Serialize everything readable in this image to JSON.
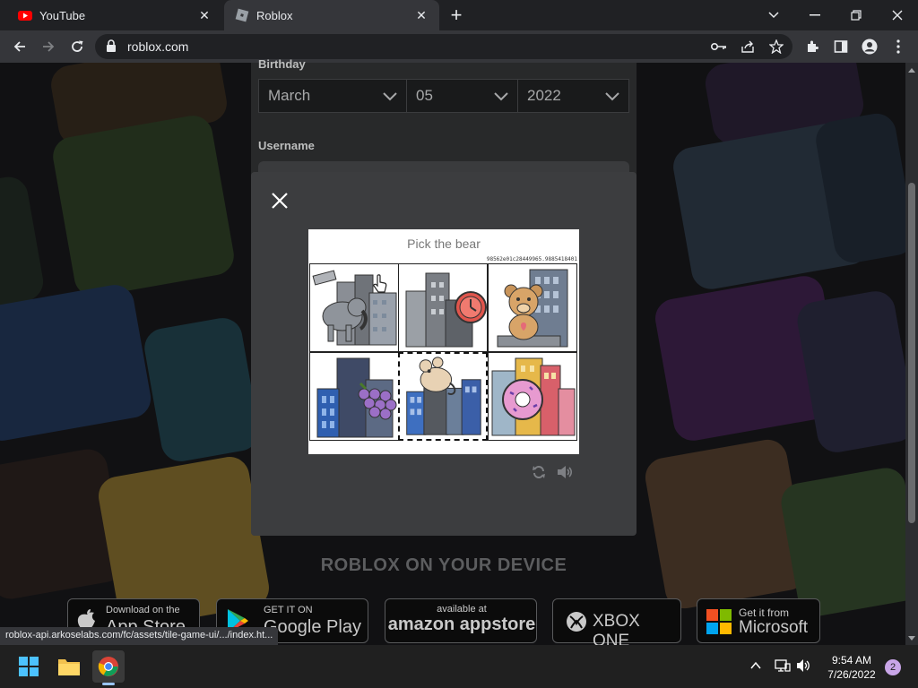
{
  "browser": {
    "tabs": [
      {
        "title": "YouTube",
        "icon": "youtube-icon",
        "active": false
      },
      {
        "title": "Roblox",
        "icon": "roblox-icon",
        "active": true
      }
    ],
    "url": "roblox.com",
    "status_url": "roblox-api.arkoselabs.com/fc/assets/tile-game-ui/.../index.ht..."
  },
  "signup": {
    "birthday_label": "Birthday",
    "month": "March",
    "day": "05",
    "year": "2022",
    "username_label": "Username"
  },
  "captcha": {
    "prompt": "Pick the bear",
    "session_id": "98562e01c28449965.9885418401",
    "tiles": [
      {
        "content": "elephant-and-buildings",
        "selected": false
      },
      {
        "content": "clock-and-buildings",
        "selected": false
      },
      {
        "content": "teddy-bear-and-building",
        "selected": false
      },
      {
        "content": "grapes-and-building",
        "selected": false
      },
      {
        "content": "mouse-and-buildings",
        "selected": true
      },
      {
        "content": "donut-and-buildings",
        "selected": false
      }
    ],
    "controls": [
      "refresh-icon",
      "audio-icon"
    ]
  },
  "devices": {
    "title": "ROBLOX ON YOUR DEVICE",
    "stores": [
      {
        "small": "Download on the",
        "big": "App Store",
        "icon": "apple-icon"
      },
      {
        "small": "GET IT ON",
        "big": "Google Play",
        "icon": "google-play-icon"
      },
      {
        "small": "available at",
        "big": "amazon appstore",
        "icon": ""
      },
      {
        "small": "",
        "big": "XBOX ONE",
        "icon": "xbox-icon"
      },
      {
        "small": "Get it from",
        "big": "Microsoft",
        "icon": "microsoft-icon"
      }
    ]
  },
  "taskbar": {
    "time": "9:54 AM",
    "date": "7/26/2022",
    "notification_count": "2"
  },
  "colors": {
    "chrome_dark": "#202124",
    "chrome_toolbar": "#35363a",
    "modal_bg": "#3c3d3f",
    "youtube_red": "#ff0000"
  }
}
